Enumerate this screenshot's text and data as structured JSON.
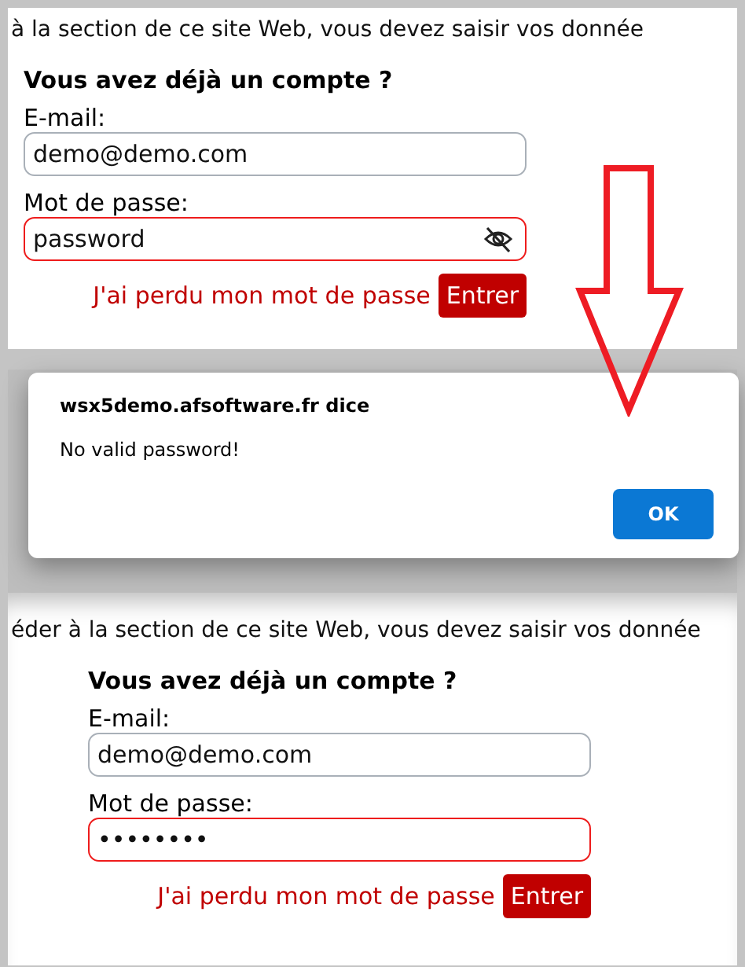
{
  "screens": [
    {
      "intro": "à la section de ce site Web, vous devez saisir vos donnée",
      "heading": "Vous avez déjà un compte ?",
      "fields": [
        {
          "label": "E-mail:",
          "value": "demo@demo.com",
          "invalid": false,
          "reveal_icon": false
        },
        {
          "label": "Mot de passe:",
          "value": "password",
          "invalid": true,
          "reveal_icon": true
        }
      ],
      "lost_link": "J'ai perdu mon mot de passe",
      "submit": "Entrer"
    },
    {
      "intro": "éder à la section de ce site Web, vous devez saisir vos donnée",
      "heading": "Vous avez déjà un compte ?",
      "fields": [
        {
          "label": "E-mail:",
          "value": "demo@demo.com",
          "invalid": false,
          "reveal_icon": false
        },
        {
          "label": "Mot de passe:",
          "value": "••••••••",
          "invalid": true,
          "reveal_icon": false
        }
      ],
      "lost_link": "J'ai perdu mon mot de passe",
      "submit": "Entrer",
      "dialog": {
        "title": "wsx5demo.afsoftware.fr dice",
        "message": "No valid password!",
        "button": "OK"
      }
    }
  ]
}
